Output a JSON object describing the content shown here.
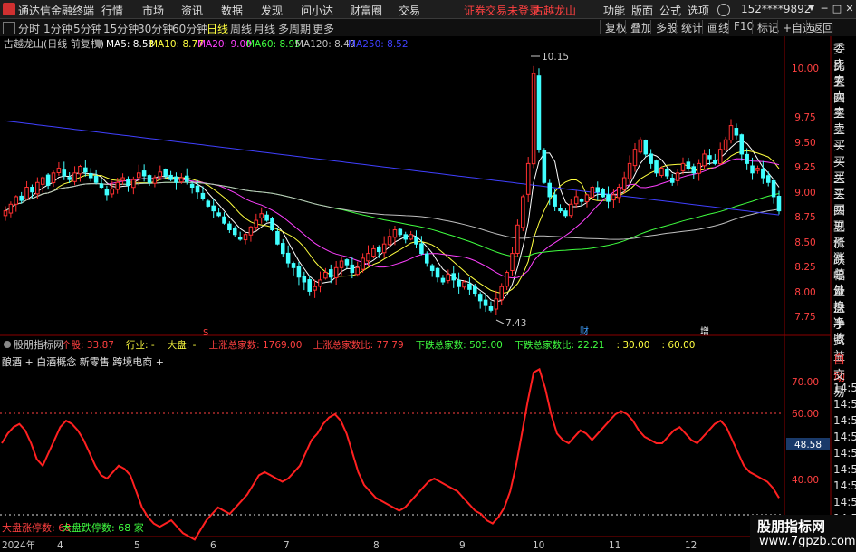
{
  "titlebar": {
    "app_name": "通达信金融终端",
    "menus": [
      "行情",
      "市场",
      "资讯",
      "数据",
      "发现",
      "问小达",
      "财富圈",
      "交易"
    ],
    "warning": "证券交易未登录",
    "stock_name": "古越龙山",
    "right_menus": [
      "功能",
      "版面",
      "公式",
      "选项"
    ],
    "account": "152****9892",
    "window_buttons": [
      "▼",
      "─",
      "□",
      "✕"
    ]
  },
  "toolbar": {
    "periods": [
      "分时",
      "1分钟",
      "5分钟",
      "15分钟",
      "30分钟",
      "60分钟",
      "日线",
      "周线",
      "月线",
      "多周期",
      "更多"
    ],
    "active_period": "日线",
    "right_tools": [
      "复权",
      "叠加",
      "多股",
      "统计",
      "画线",
      "F10",
      "标记",
      "+自选",
      "返回"
    ]
  },
  "main_chart": {
    "title": "古越龙山(日线 前复权)",
    "ma_labels": [
      {
        "label": "MA5: 8.58",
        "color": "#ffffff"
      },
      {
        "label": "MA10: 8.77",
        "color": "#ffff40"
      },
      {
        "label": "MA20: 9.00",
        "color": "#ff40ff"
      },
      {
        "label": "MA60: 8.95",
        "color": "#40ff40"
      },
      {
        "label": "MA120: 8.49",
        "color": "#c0c0c0"
      },
      {
        "label": "MA250: 8.52",
        "color": "#4040ff"
      }
    ],
    "price_axis": [
      "10.00",
      "9.75",
      "9.50",
      "9.25",
      "9.00",
      "8.75",
      "8.50",
      "8.25",
      "8.00",
      "7.75",
      "7.50"
    ],
    "high_marker": "10.15",
    "low_marker": "7.43",
    "event_markers": [
      {
        "label": "S",
        "color": "#ff4040"
      },
      {
        "label": "财",
        "color": "#40a0ff"
      },
      {
        "label": "增",
        "color": "#ffffff"
      }
    ]
  },
  "indicator": {
    "name": "股朋指标网",
    "fields": [
      {
        "label": "个股:",
        "value": "33.87",
        "color": "#ff4040"
      },
      {
        "label": "行业:",
        "value": "-",
        "color": "#ffff40"
      },
      {
        "label": "大盘:",
        "value": "-",
        "color": "#ffff40"
      },
      {
        "label": "上涨总家数:",
        "value": "1769.00",
        "color": "#ff4040"
      },
      {
        "label": "上涨总家数比:",
        "value": "77.79",
        "color": "#ff4040"
      },
      {
        "label": "下跌总家数:",
        "value": "505.00",
        "color": "#40ff40"
      },
      {
        "label": "下跌总家数比:",
        "value": "22.21",
        "color": "#40ff40"
      },
      {
        "label": ":",
        "value": "30.00",
        "color": "#ffff40"
      },
      {
        "label": ":",
        "value": "60.00",
        "color": "#ffff40"
      }
    ],
    "concepts": "酿酒 + 白酒概念 新零售 跨境电商 +",
    "axis": [
      "70.00",
      "60.00",
      "50.00",
      "40.00"
    ],
    "current_value": "48.58",
    "limit_up": "大盘涨停数: 68",
    "limit_down": "大盘跌停数: 68 家"
  },
  "date_axis": [
    "2024年",
    "4",
    "5",
    "6",
    "7",
    "8",
    "9",
    "10",
    "11",
    "12"
  ],
  "right_panel": {
    "quote_labels": [
      "委比",
      "卖五",
      "卖四",
      "卖三",
      "卖二",
      "卖一",
      "买一",
      "买二",
      "买三",
      "买四",
      "买五",
      "现价",
      "涨跌",
      "涨幅",
      "总量",
      "外盘",
      "换手",
      "净资",
      "收益"
    ],
    "tabs": [
      "自动",
      "交易"
    ],
    "times": [
      "14:56",
      "14:56",
      "14:56",
      "14:56",
      "14:56",
      "14:56",
      "14:56",
      "14:56",
      "14:56",
      "14:56"
    ]
  },
  "watermark": {
    "title": "股朋指标网",
    "url": "www.7gpzb.com"
  },
  "chart_data": {
    "type": "candlestick",
    "closes": [
      8.55,
      8.62,
      8.7,
      8.66,
      8.8,
      8.75,
      8.85,
      8.9,
      8.82,
      8.95,
      9.0,
      8.92,
      8.88,
      8.95,
      9.02,
      8.96,
      8.9,
      8.85,
      8.8,
      8.72,
      8.78,
      8.85,
      8.9,
      8.82,
      8.88,
      8.95,
      8.92,
      8.85,
      8.9,
      8.96,
      8.92,
      8.88,
      8.85,
      8.9,
      8.86,
      8.8,
      8.75,
      8.68,
      8.6,
      8.55,
      8.5,
      8.42,
      8.35,
      8.3,
      8.25,
      8.3,
      8.38,
      8.45,
      8.52,
      8.45,
      8.35,
      8.2,
      8.1,
      8.0,
      7.95,
      7.85,
      7.8,
      7.7,
      7.75,
      7.82,
      7.9,
      7.85,
      7.95,
      8.02,
      7.98,
      7.9,
      7.95,
      8.05,
      8.1,
      8.15,
      8.12,
      8.2,
      8.28,
      8.35,
      8.3,
      8.25,
      8.3,
      8.2,
      8.1,
      8.0,
      7.92,
      7.85,
      7.8,
      7.88,
      7.82,
      7.75,
      7.8,
      7.72,
      7.68,
      7.6,
      7.55,
      7.5,
      7.62,
      7.75,
      7.9,
      8.1,
      8.4,
      8.7,
      9.05,
      10.0,
      9.2,
      8.85,
      8.7,
      8.6,
      8.55,
      8.5,
      8.62,
      8.7,
      8.65,
      8.72,
      8.8,
      8.75,
      8.7,
      8.65,
      8.72,
      8.8,
      8.9,
      9.05,
      9.2,
      9.3,
      9.15,
      9.05,
      8.95,
      9.0,
      8.92,
      8.85,
      8.95,
      9.05,
      9.0,
      8.95,
      9.05,
      9.15,
      9.1,
      9.05,
      9.2,
      9.3,
      9.45,
      9.35,
      9.15,
      9.05,
      8.95,
      9.0,
      8.9,
      8.85,
      8.7,
      8.55
    ],
    "indicator_values": [
      55,
      58,
      60,
      61,
      59,
      55,
      50,
      48,
      52,
      56,
      60,
      62,
      61,
      59,
      56,
      52,
      48,
      45,
      44,
      46,
      48,
      47,
      45,
      40,
      35,
      32,
      30,
      29,
      30,
      31,
      29,
      27,
      26,
      25,
      28,
      31,
      33,
      35,
      34,
      33,
      35,
      37,
      39,
      42,
      45,
      46,
      45,
      44,
      43,
      44,
      46,
      48,
      52,
      56,
      58,
      61,
      63,
      64,
      62,
      58,
      52,
      46,
      42,
      40,
      38,
      37,
      36,
      35,
      34,
      35,
      37,
      39,
      41,
      43,
      44,
      43,
      42,
      41,
      40,
      38,
      36,
      34,
      33,
      31,
      30,
      32,
      35,
      40,
      48,
      58,
      68,
      77,
      78,
      72,
      64,
      58,
      56,
      55,
      57,
      59,
      58,
      56,
      58,
      60,
      62,
      64,
      65,
      64,
      62,
      59,
      57,
      56,
      55,
      55,
      57,
      59,
      60,
      58,
      56,
      55,
      57,
      59,
      61,
      62,
      60,
      56,
      52,
      48,
      46,
      45,
      44,
      43,
      41,
      38
    ]
  }
}
